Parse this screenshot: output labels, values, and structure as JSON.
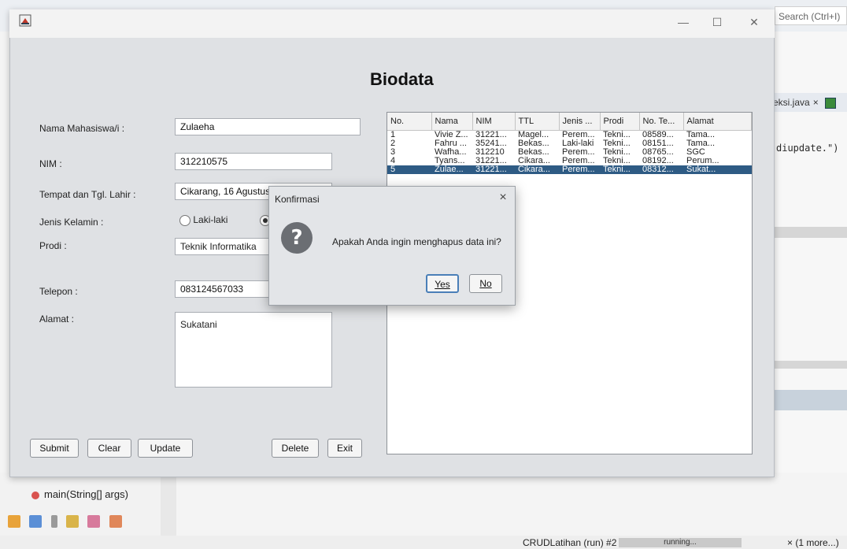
{
  "ide": {
    "search_placeholder": "Search (Ctrl+I)",
    "tab_label": "eksi.java",
    "tab_close": "×",
    "code_fragment": "diupdate.\")",
    "method_label": "main(String[] args)",
    "status_run": "CRUDLatihan (run) #2",
    "status_progress": "running...",
    "status_more": "× (1 more...)"
  },
  "window": {
    "title": "",
    "min_icon": "—",
    "max_icon": "☐",
    "close_icon": "✕"
  },
  "form": {
    "heading": "Biodata",
    "nama_label": "Nama Mahasiswa/i :",
    "nama_value": "Zulaeha",
    "nim_label": "NIM :",
    "nim_value": "312210575",
    "ttl_label": "Tempat dan Tgl. Lahir :",
    "ttl_value": "Cikarang, 16 Agustus",
    "jk_label": "Jenis Kelamin :",
    "jk_option_laki": "Laki-laki",
    "prodi_label": "Prodi :",
    "prodi_value": "Teknik Informatika",
    "telepon_label": "Telepon :",
    "telepon_value": "083124567033",
    "alamat_label": "Alamat :",
    "alamat_value": "Sukatani",
    "buttons": {
      "submit": "Submit",
      "clear": "Clear",
      "update": "Update",
      "delete": "Delete",
      "exit": "Exit"
    }
  },
  "table": {
    "columns": [
      "No.",
      "Nama",
      "NIM",
      "TTL",
      "Jenis ...",
      "Prodi",
      "No. Te...",
      "Alamat"
    ],
    "rows": [
      [
        "1",
        "Vivie Z...",
        "31221...",
        "Magel...",
        "Perem...",
        "Tekni...",
        "08589...",
        "Tama..."
      ],
      [
        "2",
        "Fahru ...",
        "35241...",
        "Bekas...",
        "Laki-laki",
        "Tekni...",
        "08151...",
        "Tama..."
      ],
      [
        "3",
        "Wafha...",
        "312210",
        "Bekas...",
        "Perem...",
        "Tekni...",
        "08765...",
        "SGC"
      ],
      [
        "4",
        "Tyans...",
        "31221...",
        "Cikara...",
        "Perem...",
        "Tekni...",
        "08192...",
        "Perum..."
      ],
      [
        "5",
        "Zulae...",
        "31221...",
        "Cikara...",
        "Perem...",
        "Tekni...",
        "08312...",
        "Sukat..."
      ]
    ],
    "selected_row": 4
  },
  "dialog": {
    "title": "Konfirmasi",
    "close": "×",
    "icon": "?",
    "message": "Apakah Anda ingin menghapus data ini?",
    "yes": "Yes",
    "no": "No"
  },
  "colors": {
    "selection": "#2e5b84",
    "window_bg": "#dfe1e4",
    "dialog_bg": "#e3e5e8"
  }
}
